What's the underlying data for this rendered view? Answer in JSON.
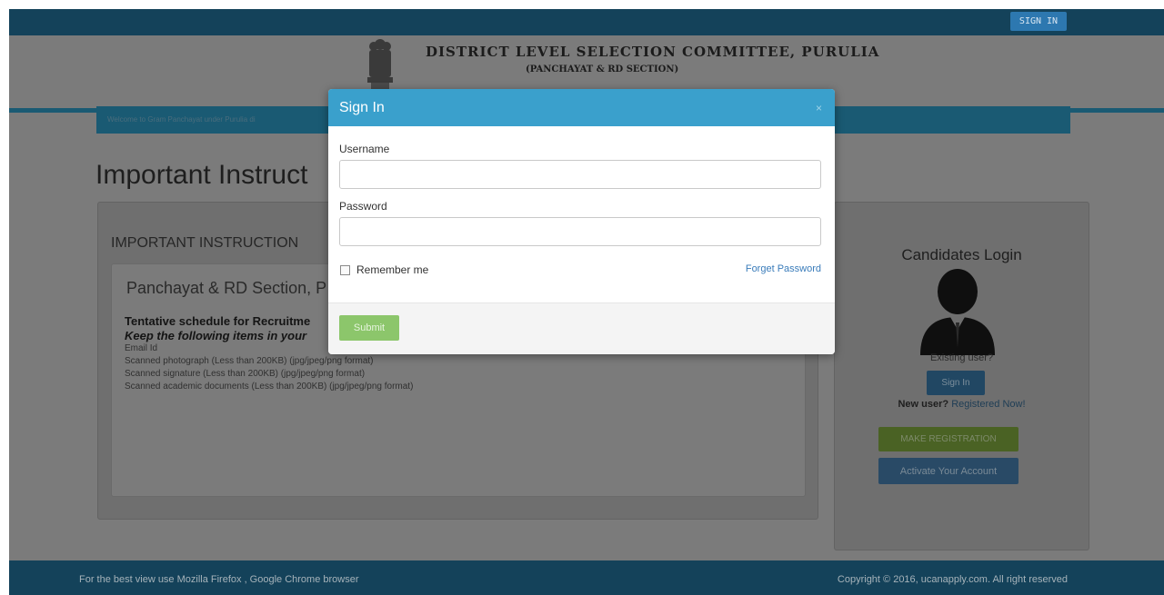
{
  "topbar": {
    "signin_label": "SIGN IN"
  },
  "header": {
    "title": "DISTRICT LEVEL SELECTION COMMITTEE, PURULIA",
    "subtitle": "(PANCHAYAT & RD SECTION)"
  },
  "welcome": {
    "text": "Welcome to Gram Panchayat under Purulia di"
  },
  "main": {
    "page_title": "Important Instruct",
    "panel_heading": "IMPORTANT INSTRUCTION",
    "inner_title": "Panchayat & RD Section, P",
    "schedule_text": "Tentative schedule for Recruitme",
    "keep_text": "Keep the following items in your",
    "requirements": [
      "Email Id",
      "Scanned photograph (Less than 200KB) (jpg/jpeg/png format)",
      "Scanned signature (Less than 200KB) (jpg/jpeg/png format)",
      "Scanned academic documents (Less than 200KB) (jpg/jpeg/png format)"
    ]
  },
  "candidates": {
    "title": "Candidates Login",
    "existing_user": "Existing user?",
    "signin_label": "Sign In",
    "new_user_label": "New user?",
    "register_link": "Registered Now!",
    "make_registration_label": "MAKE REGISTRATION",
    "activate_label": "Activate Your Account"
  },
  "footer": {
    "left_text": "For the best view use Mozilla Firefox , Google Chrome browser",
    "right_text": "Copyright © 2016, ucanapply.com. All right reserved"
  },
  "modal": {
    "title": "Sign In",
    "close_label": "×",
    "username_label": "Username",
    "username_value": "",
    "password_label": "Password",
    "password_value": "",
    "remember_label": "Remember me",
    "remember_checked": false,
    "forgot_label": "Forget Password",
    "submit_label": "Submit"
  },
  "colors": {
    "modal_header": "#3aa0cc",
    "submit_button": "#8cc66b",
    "link": "#3a7cba",
    "topbar": "#14425a"
  }
}
